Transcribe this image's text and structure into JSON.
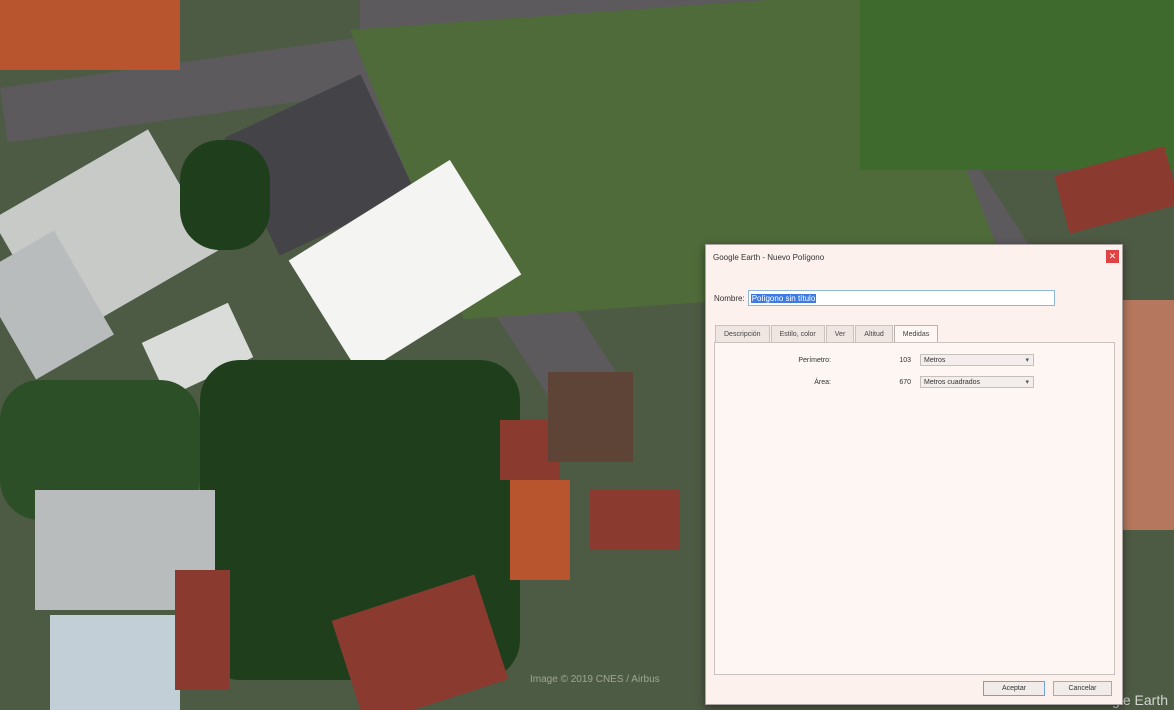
{
  "map": {
    "watermark": "Image © 2019 CNES / Airbus",
    "logo": "Google Earth"
  },
  "dialog": {
    "title": "Google Earth - Nuevo Polígono",
    "close_icon": "close-icon",
    "name_label": "Nombre:",
    "name_value": "Polígono sin título",
    "tabs": [
      {
        "label": "Descripción",
        "active": false
      },
      {
        "label": "Estilo, color",
        "active": false
      },
      {
        "label": "Ver",
        "active": false
      },
      {
        "label": "Altitud",
        "active": false
      },
      {
        "label": "Medidas",
        "active": true
      }
    ],
    "measurements": [
      {
        "label": "Perímetro:",
        "value": "103",
        "unit": "Metros"
      },
      {
        "label": "Área:",
        "value": "670",
        "unit": "Metros cuadrados"
      }
    ],
    "ok_label": "Aceptar",
    "cancel_label": "Cancelar"
  }
}
